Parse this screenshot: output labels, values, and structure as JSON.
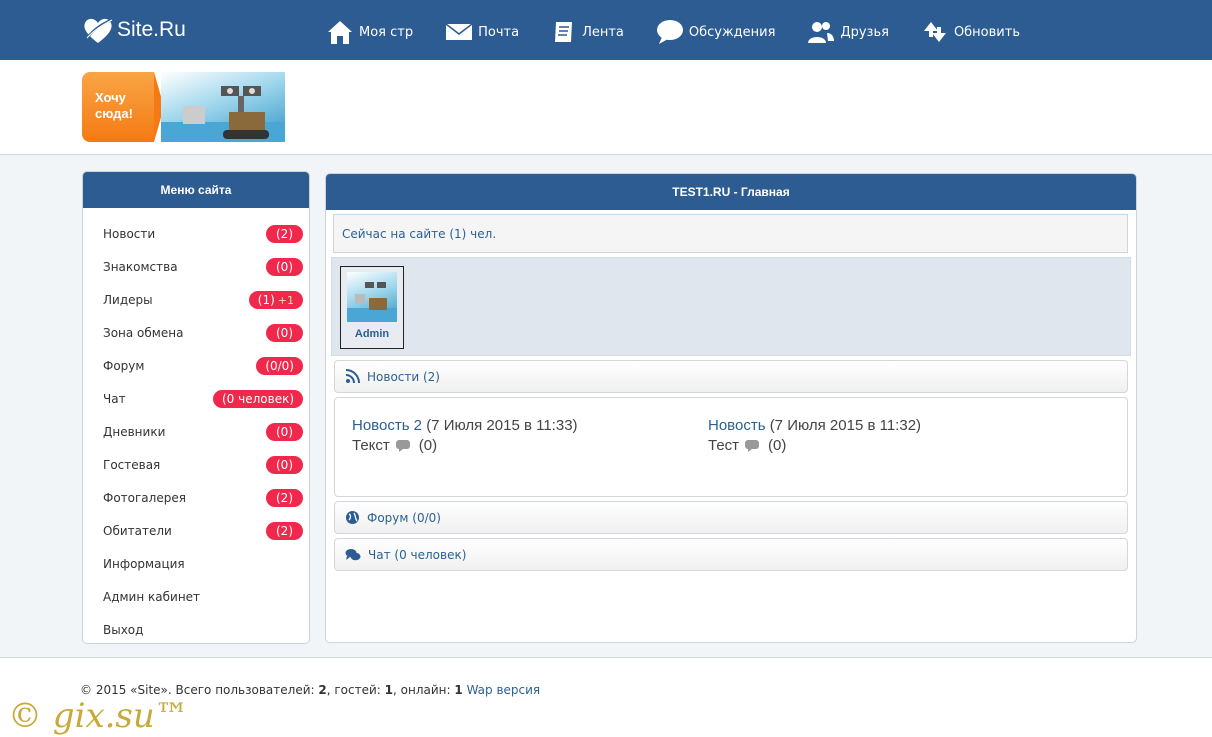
{
  "header": {
    "logo_text": "Site.Ru",
    "nav": [
      {
        "label": "Моя стр",
        "icon": "home-icon"
      },
      {
        "label": "Почта",
        "icon": "mail-icon"
      },
      {
        "label": "Лента",
        "icon": "feed-icon"
      },
      {
        "label": "Обсуждения",
        "icon": "chat-bubble-icon"
      },
      {
        "label": "Друзья",
        "icon": "friends-icon"
      },
      {
        "label": "Обновить",
        "icon": "refresh-icon"
      }
    ]
  },
  "banner": {
    "want_label": "Хочу сюда!"
  },
  "sidebar": {
    "title": "Меню сайта",
    "items": [
      {
        "label": "Новости",
        "badge": "(2)"
      },
      {
        "label": "Знакомства",
        "badge": "(0)"
      },
      {
        "label": "Лидеры",
        "badge": "(1)",
        "badge_extra": "+1"
      },
      {
        "label": "Зона обмена",
        "badge": "(0)"
      },
      {
        "label": "Форум",
        "badge": "(0/0)"
      },
      {
        "label": "Чат",
        "badge": "(0 человек)"
      },
      {
        "label": "Дневники",
        "badge": "(0)"
      },
      {
        "label": "Гостевая",
        "badge": "(0)"
      },
      {
        "label": "Фотогалерея",
        "badge": "(2)"
      },
      {
        "label": "Обитатели",
        "badge": "(2)"
      },
      {
        "label": "Информация"
      },
      {
        "label": "Админ кабинет"
      },
      {
        "label": "Выход"
      }
    ]
  },
  "main": {
    "title": "TEST1.RU - Главная",
    "online_text": "Сейчас на сайте (1) чел.",
    "users": [
      {
        "name": "Admin"
      }
    ],
    "news_section": "Новости (2)",
    "news": [
      {
        "title": "Новость 2",
        "date": "(7 Июля 2015 в 11:33)",
        "text": "Текст",
        "comments": "(0)"
      },
      {
        "title": "Новость",
        "date": "(7 Июля 2015 в 11:32)",
        "text": "Тест",
        "comments": "(0)"
      }
    ],
    "forum_section": "Форум (0/0)",
    "chat_section": "Чат (0 человек)"
  },
  "footer": {
    "prefix": "© 2015 «Site». Всего пользователей:",
    "users_count": "2",
    "guests_label": ", гостей:",
    "guests_count": "1",
    "online_label": ", онлайн:",
    "online_count": "1",
    "wap_link": "Wap версия"
  },
  "watermark": "© gix.su™",
  "colors": {
    "header_bg": "#2c5c92",
    "badge": "#f0284c",
    "link": "#2b6192",
    "orange": "#f47a13"
  }
}
